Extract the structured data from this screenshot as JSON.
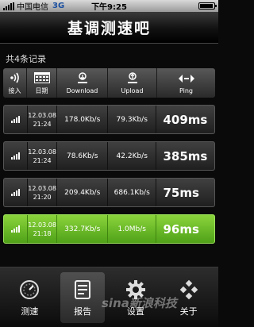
{
  "status_bar": {
    "carrier": "中国电信",
    "network": "3G",
    "time": "下午9:25"
  },
  "title": "基调测速吧",
  "record_count": "共4条记录",
  "columns": [
    {
      "label": "接入",
      "icon": "signal-access-icon"
    },
    {
      "label": "日期",
      "icon": "calendar-icon"
    },
    {
      "label": "Download",
      "icon": "download-icon"
    },
    {
      "label": "Upload",
      "icon": "upload-icon"
    },
    {
      "label": "Ping",
      "icon": "ping-icon"
    }
  ],
  "records": [
    {
      "date": "12.03.08",
      "time": "21:24",
      "download": "178.0Kb/s",
      "upload": "79.3Kb/s",
      "ping": "409ms",
      "highlighted": false
    },
    {
      "date": "12.03.08",
      "time": "21:24",
      "download": "78.6Kb/s",
      "upload": "42.2Kb/s",
      "ping": "385ms",
      "highlighted": false
    },
    {
      "date": "12.03.08",
      "time": "21:20",
      "download": "209.4Kb/s",
      "upload": "686.1Kb/s",
      "ping": "75ms",
      "highlighted": false
    },
    {
      "date": "12.03.08",
      "time": "21:18",
      "download": "332.7Kb/s",
      "upload": "1.0Mb/s",
      "ping": "96ms",
      "highlighted": true
    }
  ],
  "tabs": [
    {
      "label": "测速",
      "icon": "speedometer-icon",
      "active": false
    },
    {
      "label": "报告",
      "icon": "report-icon",
      "active": true
    },
    {
      "label": "设置",
      "icon": "gear-icon",
      "active": false
    },
    {
      "label": "关于",
      "icon": "about-icon",
      "active": false
    }
  ],
  "watermark": "sina新浪科技",
  "colors": {
    "highlight": "#6cc02a",
    "title_bg": "#111111"
  }
}
